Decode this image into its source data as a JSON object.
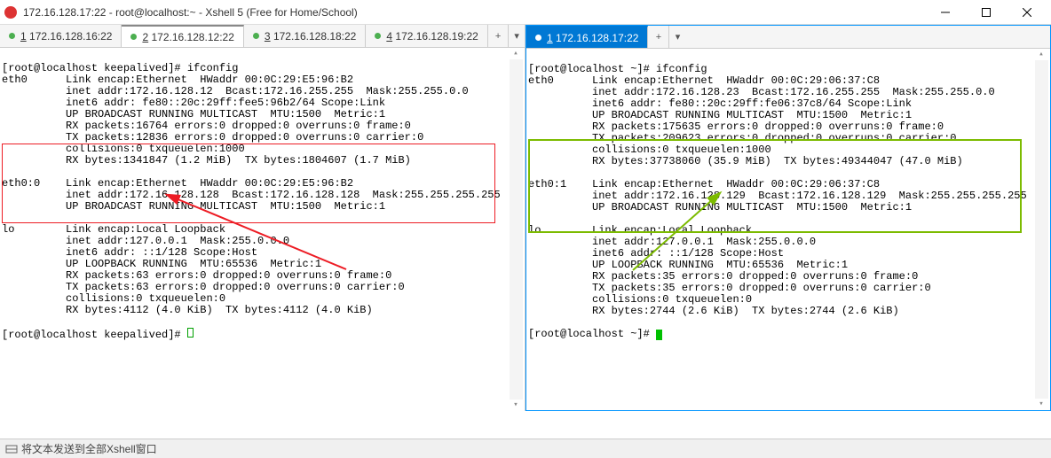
{
  "window": {
    "title": "172.16.128.17:22 - root@localhost:~ - Xshell 5 (Free for Home/School)"
  },
  "tabsLeft": [
    {
      "num": "1",
      "label": "172.16.128.16:22",
      "active": false
    },
    {
      "num": "2",
      "label": "172.16.128.12:22",
      "active": true
    },
    {
      "num": "3",
      "label": "172.16.128.18:22",
      "active": false
    },
    {
      "num": "4",
      "label": "172.16.128.19:22",
      "active": false
    }
  ],
  "tabsRight": [
    {
      "num": "1",
      "label": "172.16.128.17:22",
      "active": true
    }
  ],
  "left": {
    "prompt1": "[root@localhost keepalived]# ifconfig",
    "eth0_l1": "eth0      Link encap:Ethernet  HWaddr 00:0C:29:E5:96:B2",
    "eth0_l2": "          inet addr:172.16.128.12  Bcast:172.16.255.255  Mask:255.255.0.0",
    "eth0_l3": "          inet6 addr: fe80::20c:29ff:fee5:96b2/64 Scope:Link",
    "eth0_l4": "          UP BROADCAST RUNNING MULTICAST  MTU:1500  Metric:1",
    "eth0_l5": "          RX packets:16764 errors:0 dropped:0 overruns:0 frame:0",
    "eth0_l6": "          TX packets:12836 errors:0 dropped:0 overruns:0 carrier:0",
    "eth0_l7": "          collisions:0 txqueuelen:1000",
    "eth0_l8": "          RX bytes:1341847 (1.2 MiB)  TX bytes:1804607 (1.7 MiB)",
    "eth00_l1": "eth0:0    Link encap:Ethernet  HWaddr 00:0C:29:E5:96:B2",
    "eth00_l2": "          inet addr:172.16.128.128  Bcast:172.16.128.128  Mask:255.255.255.255",
    "eth00_l3": "          UP BROADCAST RUNNING MULTICAST  MTU:1500  Metric:1",
    "lo_l1": "lo        Link encap:Local Loopback",
    "lo_l2": "          inet addr:127.0.0.1  Mask:255.0.0.0",
    "lo_l3": "          inet6 addr: ::1/128 Scope:Host",
    "lo_l4": "          UP LOOPBACK RUNNING  MTU:65536  Metric:1",
    "lo_l5": "          RX packets:63 errors:0 dropped:0 overruns:0 frame:0",
    "lo_l6": "          TX packets:63 errors:0 dropped:0 overruns:0 carrier:0",
    "lo_l7": "          collisions:0 txqueuelen:0",
    "lo_l8": "          RX bytes:4112 (4.0 KiB)  TX bytes:4112 (4.0 KiB)",
    "prompt2": "[root@localhost keepalived]# "
  },
  "right": {
    "prompt1": "[root@localhost ~]# ifconfig",
    "eth0_l1": "eth0      Link encap:Ethernet  HWaddr 00:0C:29:06:37:C8",
    "eth0_l2": "          inet addr:172.16.128.23  Bcast:172.16.255.255  Mask:255.255.0.0",
    "eth0_l3": "          inet6 addr: fe80::20c:29ff:fe06:37c8/64 Scope:Link",
    "eth0_l4": "          UP BROADCAST RUNNING MULTICAST  MTU:1500  Metric:1",
    "eth0_l5": "          RX packets:175635 errors:0 dropped:0 overruns:0 frame:0",
    "eth0_l6": "          TX packets:209623 errors:0 dropped:0 overruns:0 carrier:0",
    "eth0_l7": "          collisions:0 txqueuelen:1000",
    "eth0_l8": "          RX bytes:37738060 (35.9 MiB)  TX bytes:49344047 (47.0 MiB)",
    "eth01_l1": "eth0:1    Link encap:Ethernet  HWaddr 00:0C:29:06:37:C8",
    "eth01_l2": "          inet addr:172.16.128.129  Bcast:172.16.128.129  Mask:255.255.255.255",
    "eth01_l3": "          UP BROADCAST RUNNING MULTICAST  MTU:1500  Metric:1",
    "lo_l1": "lo        Link encap:Local Loopback",
    "lo_l2": "          inet addr:127.0.0.1  Mask:255.0.0.0",
    "lo_l3": "          inet6 addr: ::1/128 Scope:Host",
    "lo_l4": "          UP LOOPBACK RUNNING  MTU:65536  Metric:1",
    "lo_l5": "          RX packets:35 errors:0 dropped:0 overruns:0 frame:0",
    "lo_l6": "          TX packets:35 errors:0 dropped:0 overruns:0 carrier:0",
    "lo_l7": "          collisions:0 txqueuelen:0",
    "lo_l8": "          RX bytes:2744 (2.6 KiB)  TX bytes:2744 (2.6 KiB)",
    "prompt2": "[root@localhost ~]# "
  },
  "status": {
    "text": "将文本发送到全部Xshell窗口"
  },
  "annotations": {
    "left_box_color": "#ed1c24",
    "right_box_color": "#7cbb00"
  }
}
